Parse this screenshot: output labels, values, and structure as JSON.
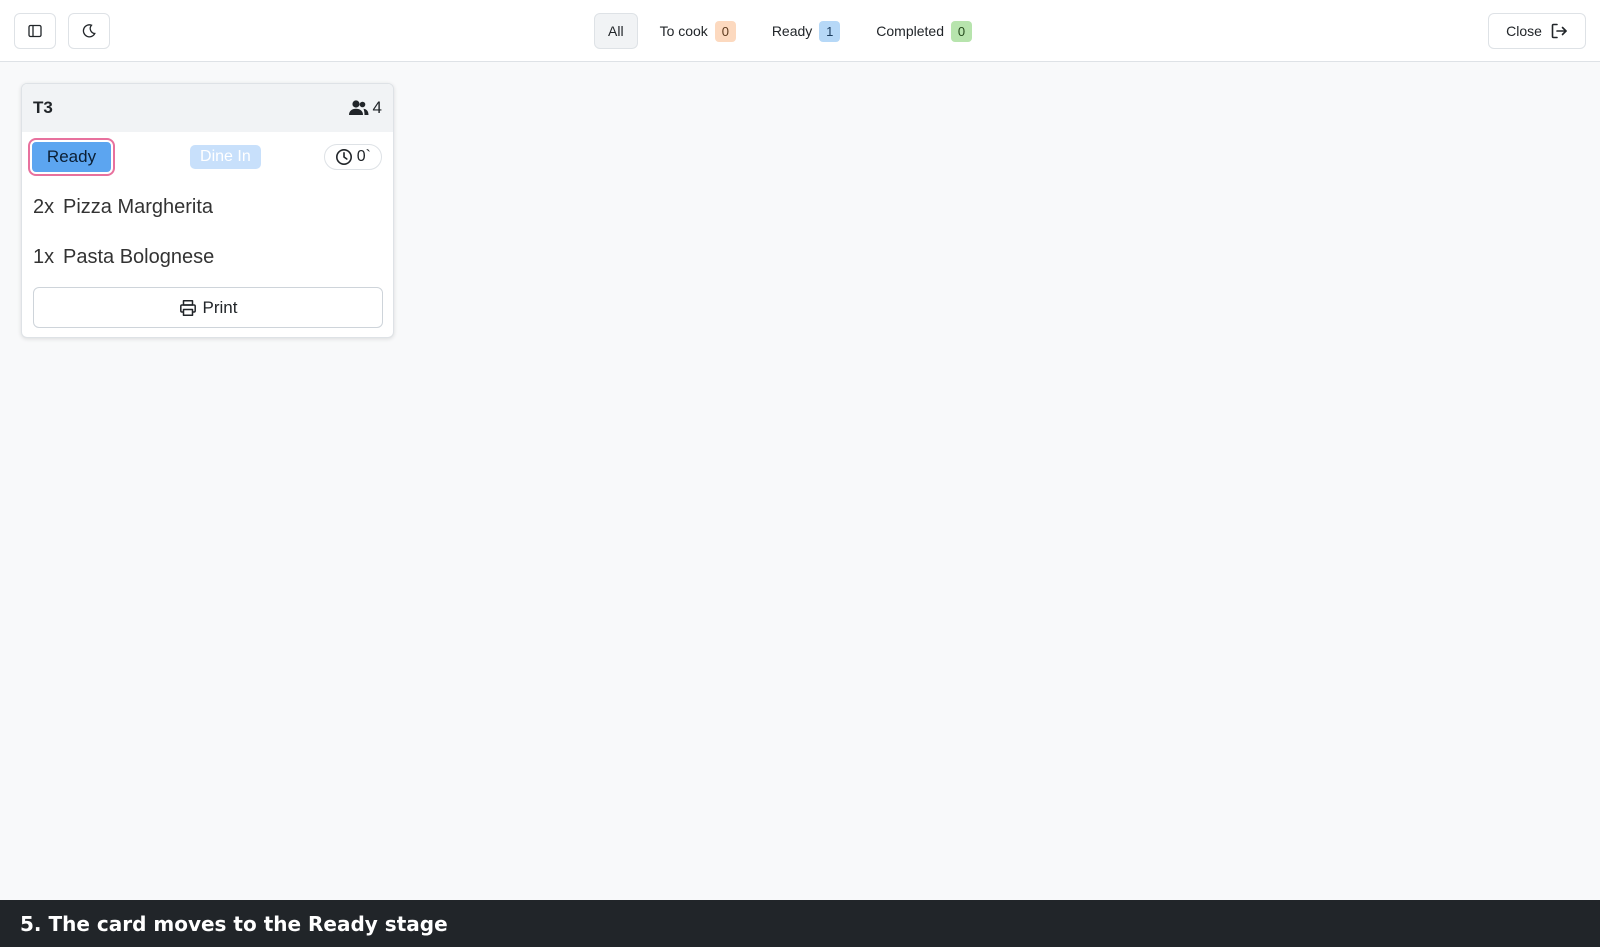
{
  "topbar": {
    "tabs": [
      {
        "label": "All",
        "count": null
      },
      {
        "label": "To cook",
        "count": "0"
      },
      {
        "label": "Ready",
        "count": "1"
      },
      {
        "label": "Completed",
        "count": "0"
      }
    ],
    "close_label": "Close"
  },
  "order_card": {
    "table": "T3",
    "guests": "4",
    "status_label": "Ready",
    "order_type": "Dine In",
    "timer": "0`",
    "items": [
      {
        "qty": "2x",
        "name": "Pizza Margherita"
      },
      {
        "qty": "1x",
        "name": "Pasta Bolognese"
      }
    ],
    "print_label": "Print"
  },
  "caption": "5. The card moves to the Ready stage",
  "colors": {
    "ready_status": "#5ca5f0",
    "focus_ring": "#e8719e",
    "to_cook_badge": "#fcd9bf",
    "ready_badge": "#b6d8f7",
    "completed_badge": "#b7e4ad"
  },
  "icons": {
    "sidebar_toggle": "sidebar-toggle-icon",
    "theme": "moon-icon",
    "close": "logout-icon",
    "guests": "users-icon",
    "timer": "clock-icon",
    "print": "printer-icon"
  }
}
